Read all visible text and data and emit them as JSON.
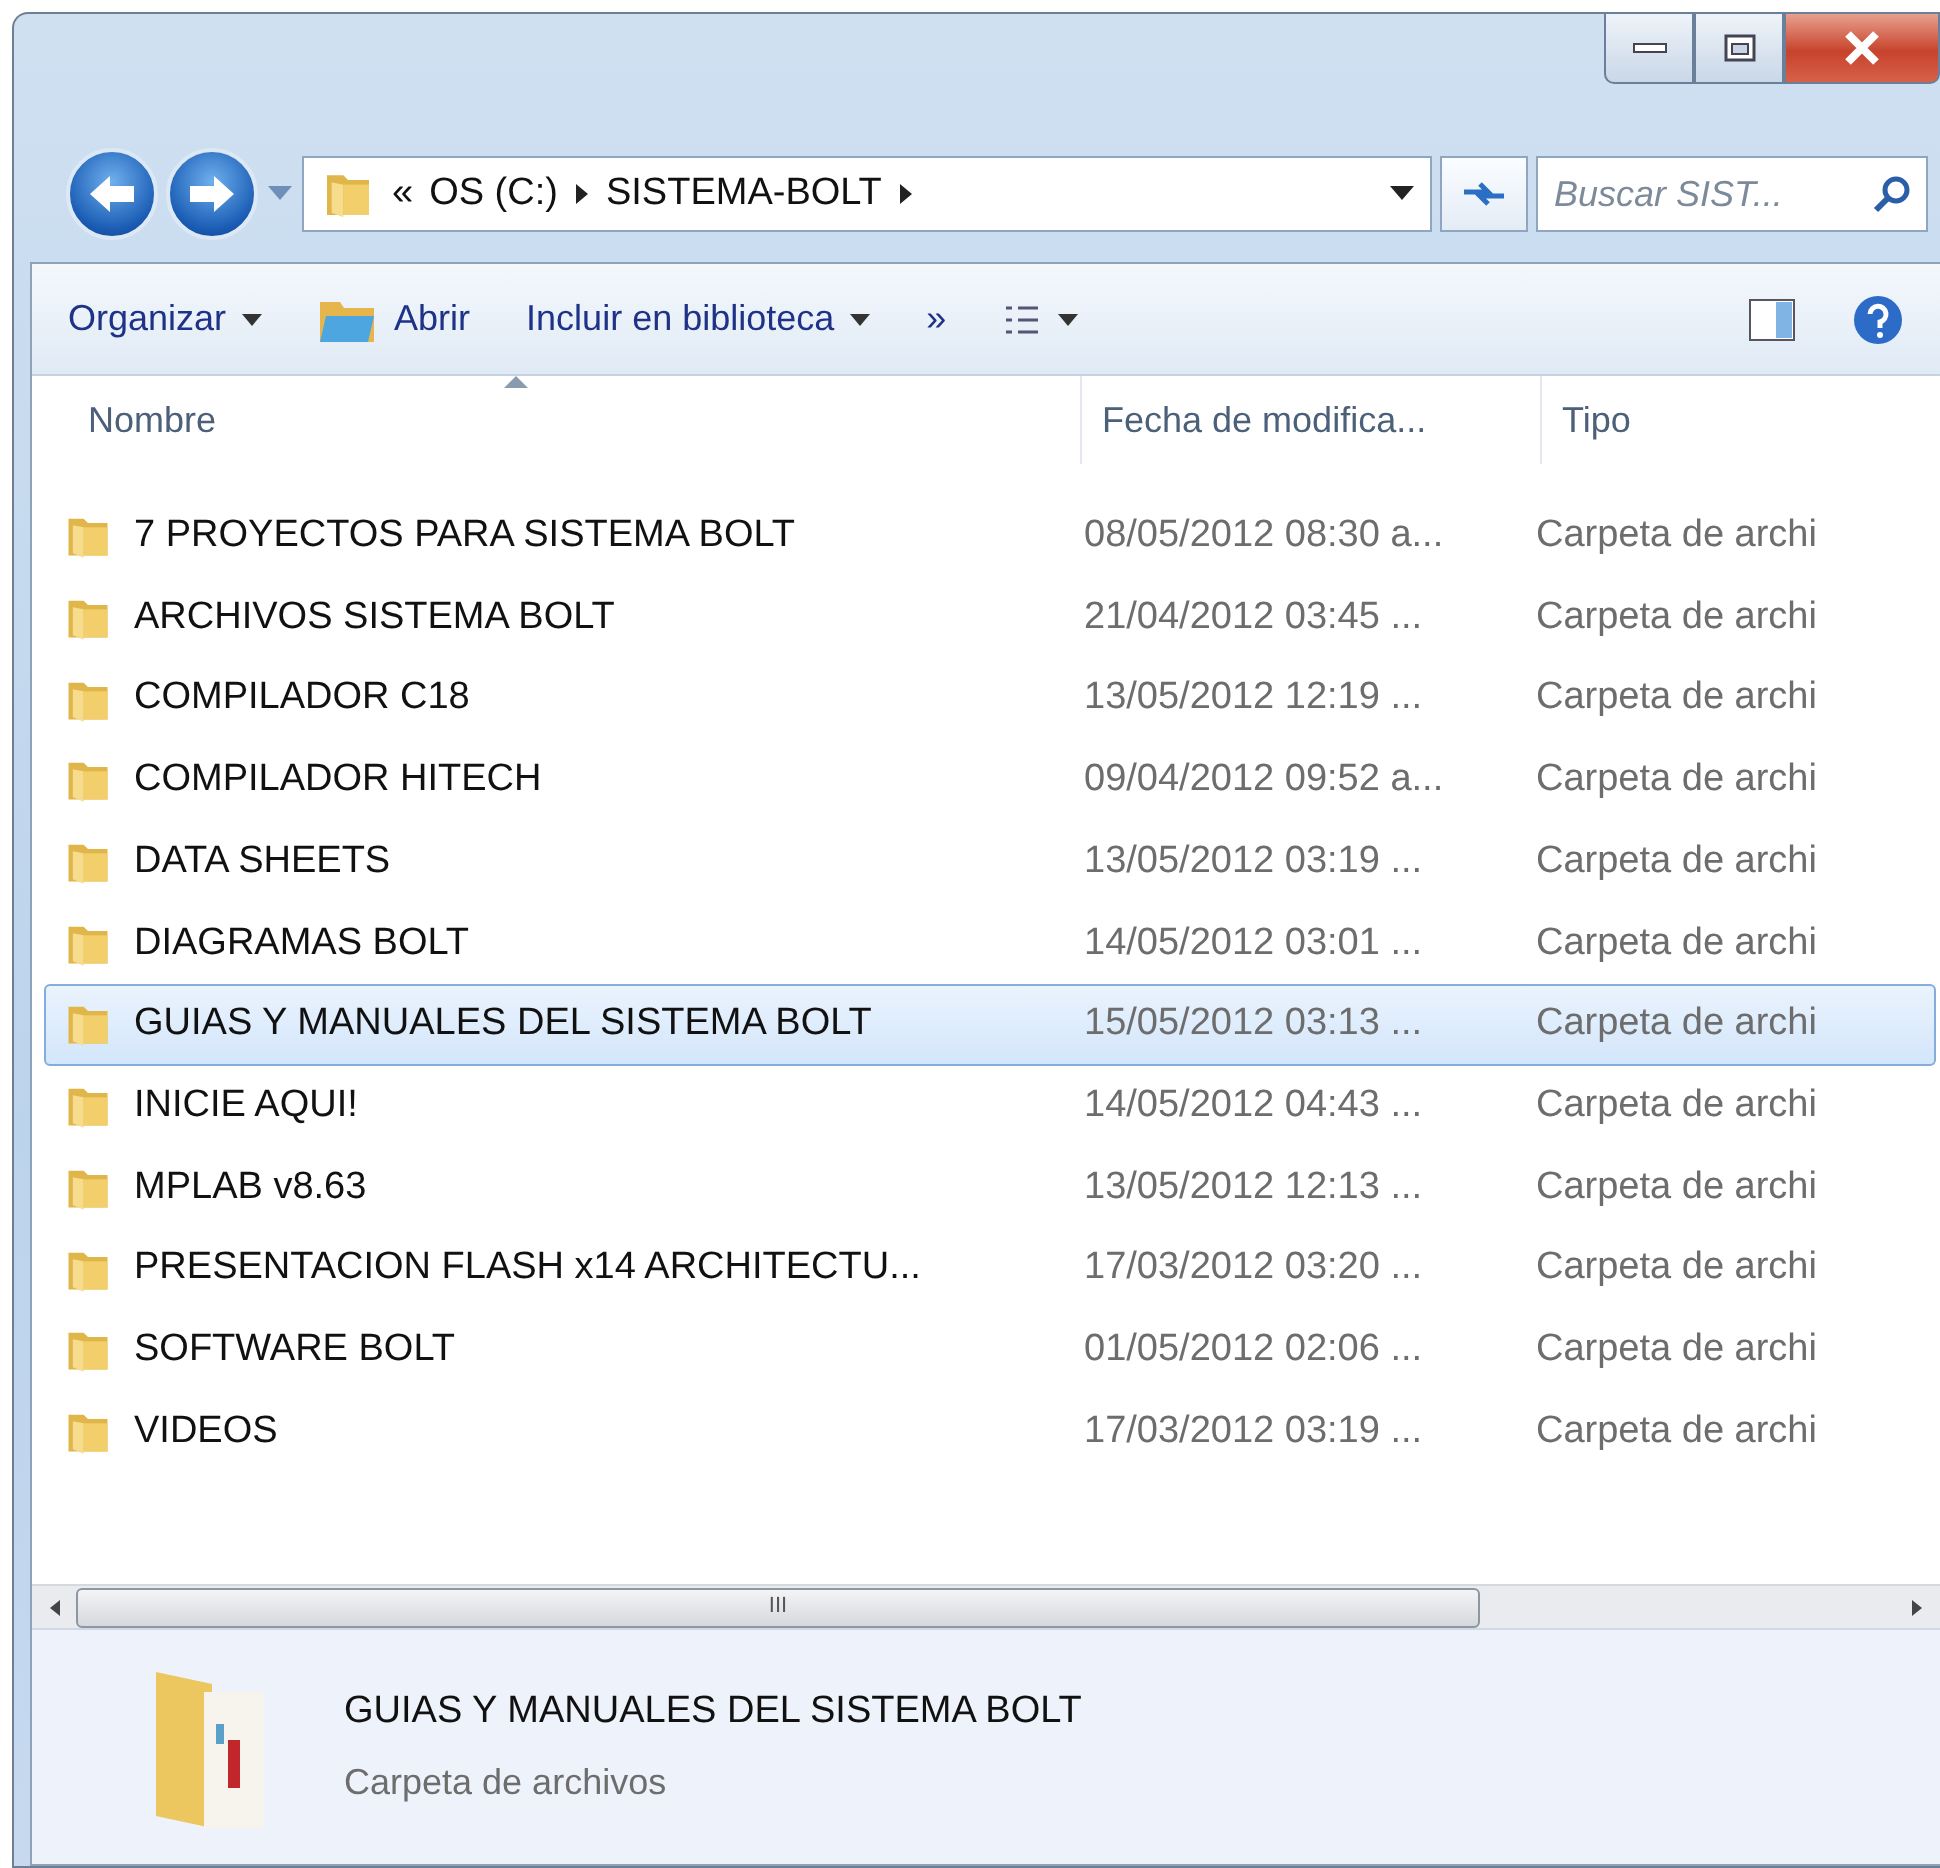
{
  "address": {
    "overflow": "«",
    "crumbs": [
      "OS (C:)",
      "SISTEMA-BOLT"
    ]
  },
  "search": {
    "placeholder": "Buscar SIST..."
  },
  "toolbar": [
    {
      "kind": "menu",
      "label": "Organizar"
    },
    {
      "kind": "open",
      "label": "Abrir"
    },
    {
      "kind": "menu",
      "label": "Incluir en biblioteca"
    },
    {
      "kind": "more",
      "label": "»"
    },
    {
      "kind": "views"
    },
    {
      "kind": "pane"
    },
    {
      "kind": "help"
    }
  ],
  "columns": [
    {
      "label": "Nombre",
      "sorted": true
    },
    {
      "label": "Fecha de modifica...",
      "sorted": false
    },
    {
      "label": "Tipo",
      "sorted": false
    }
  ],
  "rows": [
    {
      "name": "7 PROYECTOS PARA SISTEMA BOLT",
      "date": "08/05/2012 08:30 a...",
      "type": "Carpeta de archi",
      "selected": false
    },
    {
      "name": "ARCHIVOS SISTEMA BOLT",
      "date": "21/04/2012 03:45 ...",
      "type": "Carpeta de archi",
      "selected": false
    },
    {
      "name": "COMPILADOR C18",
      "date": "13/05/2012 12:19 ...",
      "type": "Carpeta de archi",
      "selected": false
    },
    {
      "name": "COMPILADOR HITECH",
      "date": "09/04/2012 09:52 a...",
      "type": "Carpeta de archi",
      "selected": false
    },
    {
      "name": "DATA SHEETS",
      "date": "13/05/2012 03:19 ...",
      "type": "Carpeta de archi",
      "selected": false
    },
    {
      "name": "DIAGRAMAS BOLT",
      "date": "14/05/2012 03:01 ...",
      "type": "Carpeta de archi",
      "selected": false
    },
    {
      "name": "GUIAS Y MANUALES DEL SISTEMA BOLT",
      "date": "15/05/2012 03:13 ...",
      "type": "Carpeta de archi",
      "selected": true
    },
    {
      "name": "INICIE AQUI!",
      "date": "14/05/2012 04:43 ...",
      "type": "Carpeta de archi",
      "selected": false
    },
    {
      "name": "MPLAB v8.63",
      "date": "13/05/2012 12:13 ...",
      "type": "Carpeta de archi",
      "selected": false
    },
    {
      "name": "PRESENTACION FLASH x14 ARCHITECTU...",
      "date": "17/03/2012 03:20 ...",
      "type": "Carpeta de archi",
      "selected": false
    },
    {
      "name": "SOFTWARE BOLT",
      "date": "01/05/2012 02:06 ...",
      "type": "Carpeta de archi",
      "selected": false
    },
    {
      "name": "VIDEOS",
      "date": "17/03/2012 03:19 ...",
      "type": "Carpeta de archi",
      "selected": false
    }
  ],
  "scrollbar_grip": "III",
  "details": {
    "name": "GUIAS Y MANUALES DEL SISTEMA BOLT",
    "type": "Carpeta de archivos"
  }
}
